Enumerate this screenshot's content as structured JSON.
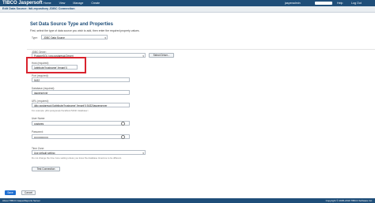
{
  "header": {
    "logo": "TIBCO Jaspersoft",
    "nav": [
      "Home",
      "View",
      "Manage",
      "Create"
    ],
    "username": "jasperadmin",
    "help_label": "Help",
    "logout_label": "Log Out"
  },
  "title_bar": "Edit Data Source: /tdi-repository JDBC Connection",
  "panel": {
    "heading": "Set Data Source Type and Properties",
    "description": "First, select the type of data source you wish to add, then enter the required property values."
  },
  "form": {
    "type_label": "Type:",
    "type_value": "JDBC Data Source",
    "driver_label": "JDBC Driver:",
    "driver_value": "PostgreSQL (org.postgresql.Driver)",
    "select_driver_button": "Select Driver...",
    "host_label": "Host (required):",
    "host_value": "{attribute('hostname','tenant')}",
    "port_label": "Port (required):",
    "port_value": "5432",
    "database_label": "Database (required):",
    "database_value": "jasperserver",
    "url_label": "URL (required):",
    "url_value": "jdbc:postgresql://{attribute('hostname','tenant')}:5432/jasperserver",
    "url_hint": "For example: jdbc:postgresql://localhost:5432/<database>",
    "username_label": "User Name:",
    "username_value": "postgres",
    "password_label": "Password:",
    "password_value": "••••••••••••••••",
    "timezone_label": "Time Zone:",
    "timezone_value": "Use default setting",
    "timezone_hint": "Do not change the time zone setting unless you know the database timezone to be different.",
    "test_connection_button": "Test Connection"
  },
  "actions": {
    "save": "Save",
    "cancel": "Cancel"
  },
  "footer": {
    "left": "About TIBCO JasperReports Server",
    "right": "Copyright © 2005-2019 TIBCO Software Inc."
  },
  "colors": {
    "header_bg": "#1f4e79",
    "highlight": "#d9232e",
    "save_button": "#1f6fd1"
  }
}
